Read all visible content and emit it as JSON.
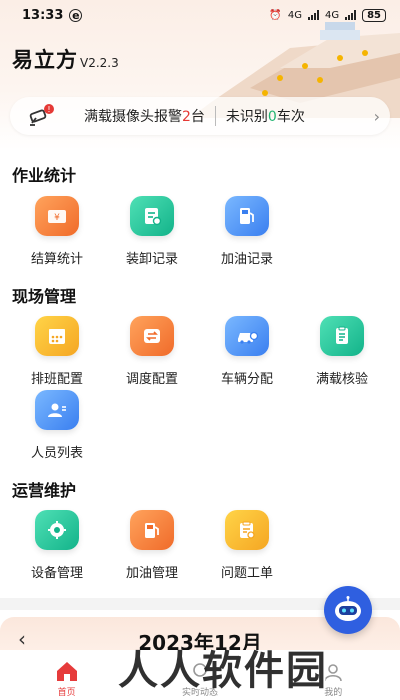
{
  "status_bar": {
    "time": "13:33",
    "network": "4G",
    "network2": "4G",
    "battery": "85"
  },
  "header": {
    "app_name": "易立方",
    "version": "V2.2.3"
  },
  "notice": {
    "alarm_prefix": "满载摄像头报警",
    "alarm_count": "2",
    "alarm_suffix": "台",
    "unrecognized_prefix": "未识别",
    "unrecognized_count": "0",
    "unrecognized_suffix": "车次"
  },
  "sections": {
    "work_stats": {
      "title": "作业统计",
      "items": [
        {
          "label": "结算统计",
          "icon": "settlement-icon"
        },
        {
          "label": "装卸记录",
          "icon": "loading-record-icon"
        },
        {
          "label": "加油记录",
          "icon": "fuel-record-icon"
        }
      ]
    },
    "site_mgmt": {
      "title": "现场管理",
      "items": [
        {
          "label": "排班配置",
          "icon": "schedule-icon"
        },
        {
          "label": "调度配置",
          "icon": "dispatch-icon"
        },
        {
          "label": "车辆分配",
          "icon": "vehicle-icon"
        },
        {
          "label": "满载核验",
          "icon": "verify-icon"
        },
        {
          "label": "人员列表",
          "icon": "people-icon"
        }
      ]
    },
    "ops": {
      "title": "运营维护",
      "items": [
        {
          "label": "设备管理",
          "icon": "device-icon"
        },
        {
          "label": "加油管理",
          "icon": "fuel-manage-icon"
        },
        {
          "label": "问题工单",
          "icon": "ticket-icon"
        }
      ]
    }
  },
  "calendar": {
    "title": "2023年12月"
  },
  "tabs": [
    {
      "label": "首页",
      "active": true
    },
    {
      "label": "实时动态",
      "active": false
    },
    {
      "label": "我的",
      "active": false
    }
  ],
  "watermark": "人人软件园",
  "colors": {
    "accent": "#e63b3b",
    "orange": "#f06b2a",
    "teal": "#13b38a",
    "blue": "#3a7ff0",
    "yellow": "#f5a623"
  }
}
